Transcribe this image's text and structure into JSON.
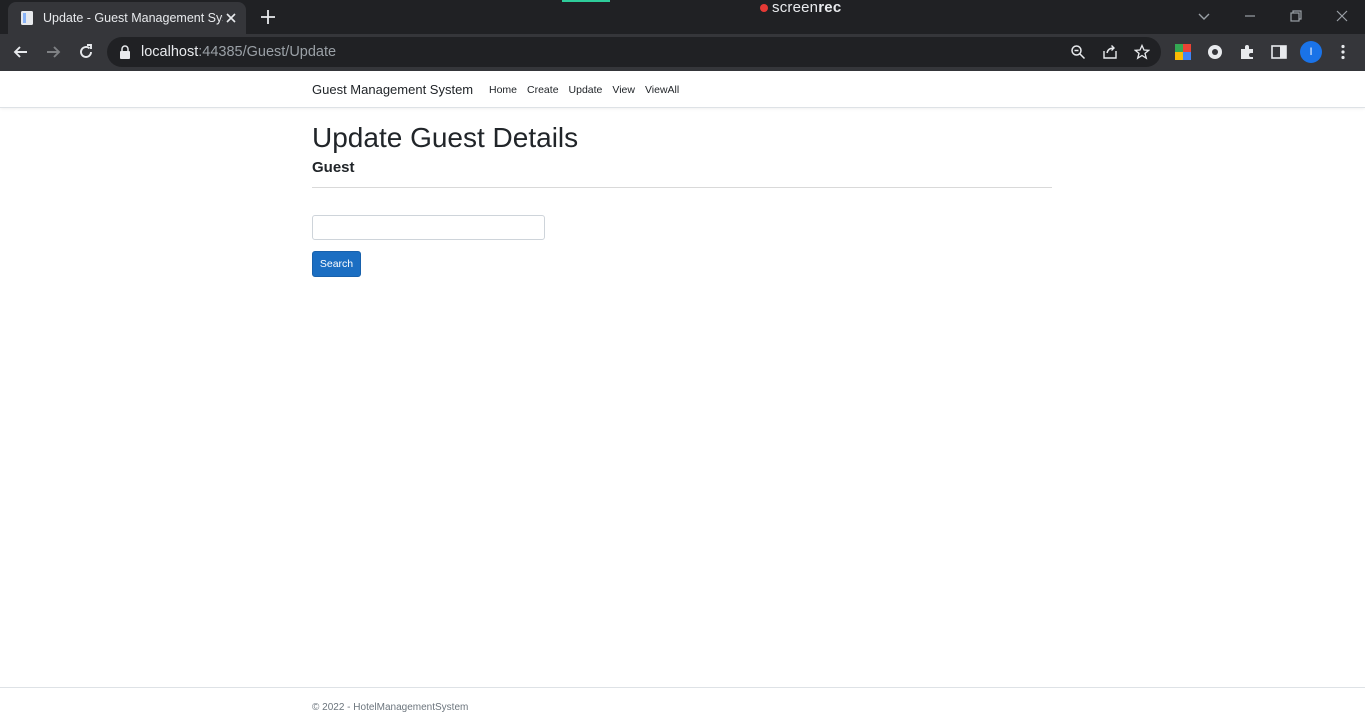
{
  "browser": {
    "tab": {
      "title": "Update - Guest Management System"
    },
    "recorder": {
      "prefix": "screen",
      "suffix": "rec"
    },
    "address": {
      "host": "localhost",
      "rest": ":44385/Guest/Update"
    },
    "profile_initial": "I"
  },
  "navbar": {
    "brand": "Guest Management System",
    "links": [
      "Home",
      "Create",
      "Update",
      "View",
      "ViewAll"
    ]
  },
  "main": {
    "heading": "Update Guest Details",
    "subheading": "Guest",
    "search": {
      "value": "",
      "button_label": "Search"
    }
  },
  "footer": {
    "text": "© 2022 - HotelManagementSystem"
  },
  "colors": {
    "primary_button": "#1b6ec2",
    "chrome_dark": "#202124",
    "chrome_toolbar": "#35363a"
  }
}
